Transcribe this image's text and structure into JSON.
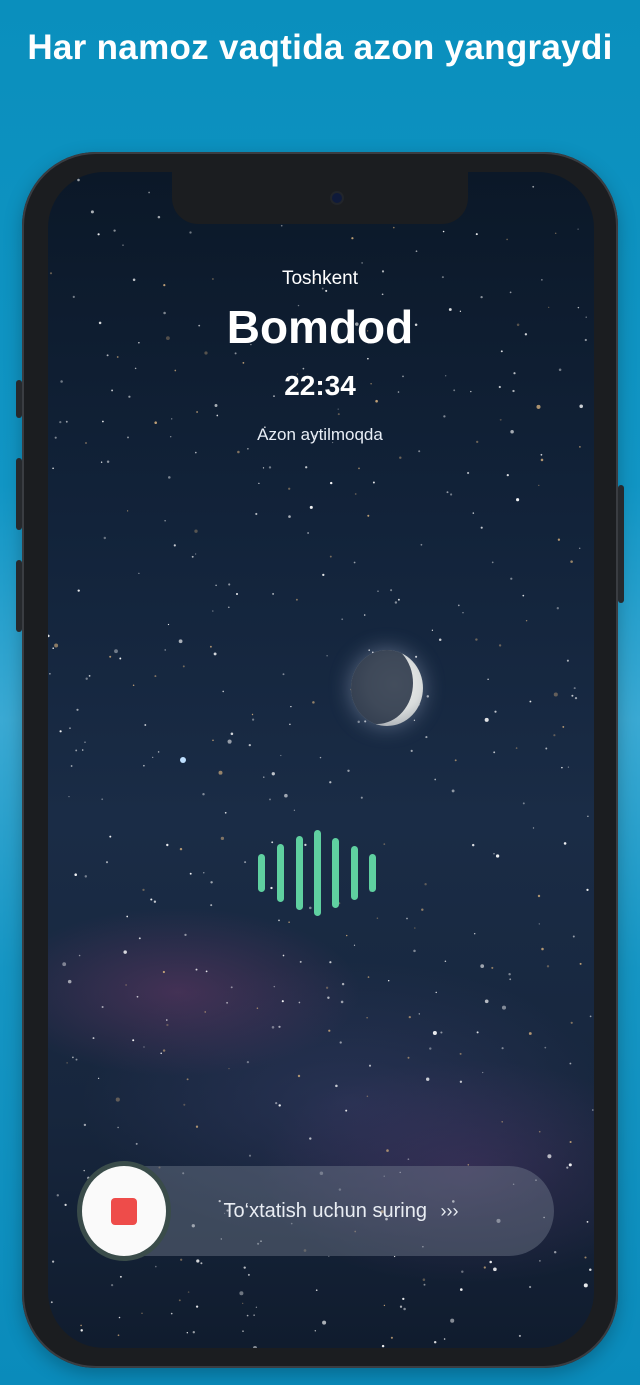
{
  "headline": "Har namoz vaqtida azon yangraydi",
  "city": "Toshkent",
  "prayer_name": "Bomdod",
  "time": "22:34",
  "status": "Azon aytilmoqda",
  "slider": {
    "label": "To‘xtatish uchun suring",
    "arrows": "›››"
  },
  "icons": {
    "stop": "stop-square-icon",
    "sound": "sound-wave-icon",
    "moon": "moon-icon"
  },
  "colors": {
    "background": "#0a8fbd",
    "accent_wave": "#5fd0a0",
    "stop_red": "#ee4c4a"
  }
}
